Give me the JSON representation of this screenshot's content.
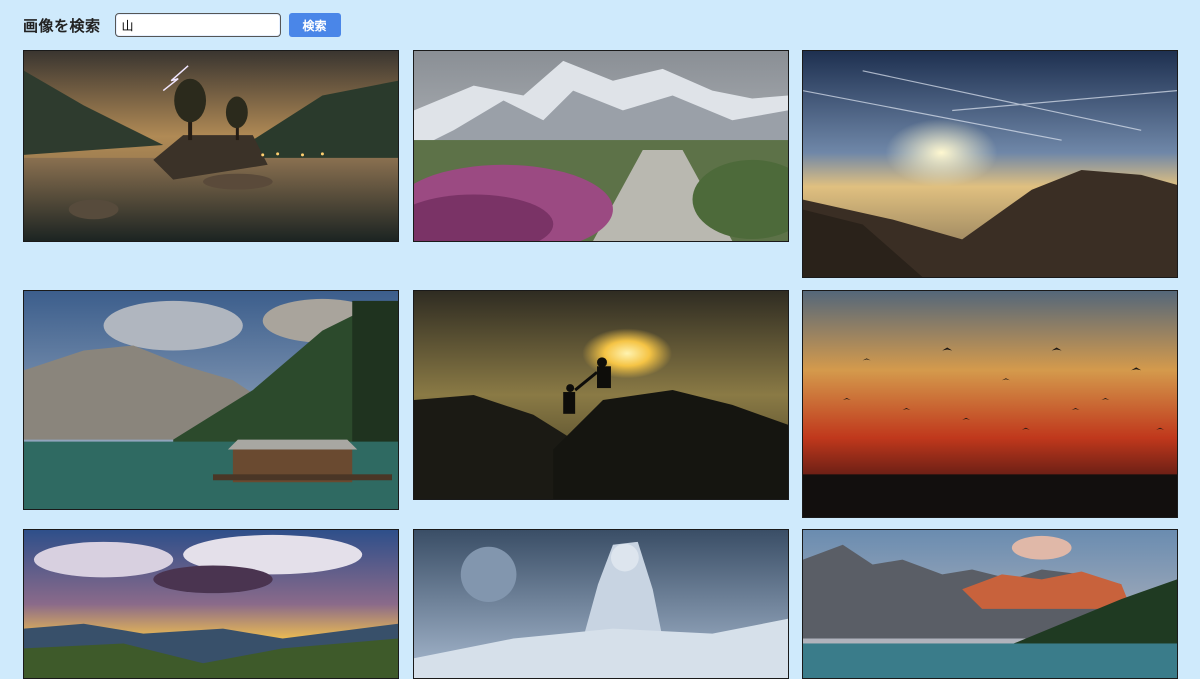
{
  "search": {
    "label": "画像を検索",
    "value": "山",
    "button_label": "検索"
  },
  "results": [
    {
      "subject": "lake-with-trees-lightning"
    },
    {
      "subject": "snowy-mountains-stone-path-heather"
    },
    {
      "subject": "sunset-above-clouds-mountain"
    },
    {
      "subject": "alpine-lake-boathouse"
    },
    {
      "subject": "climbers-helping-hand-sunset"
    },
    {
      "subject": "red-sunset-birds"
    },
    {
      "subject": "sunbeams-over-hills"
    },
    {
      "subject": "stone-giant-moon-fantasy"
    },
    {
      "subject": "canadian-rockies-lake"
    }
  ],
  "colors": {
    "background": "#cfeafc",
    "button": "#4a86e8"
  }
}
